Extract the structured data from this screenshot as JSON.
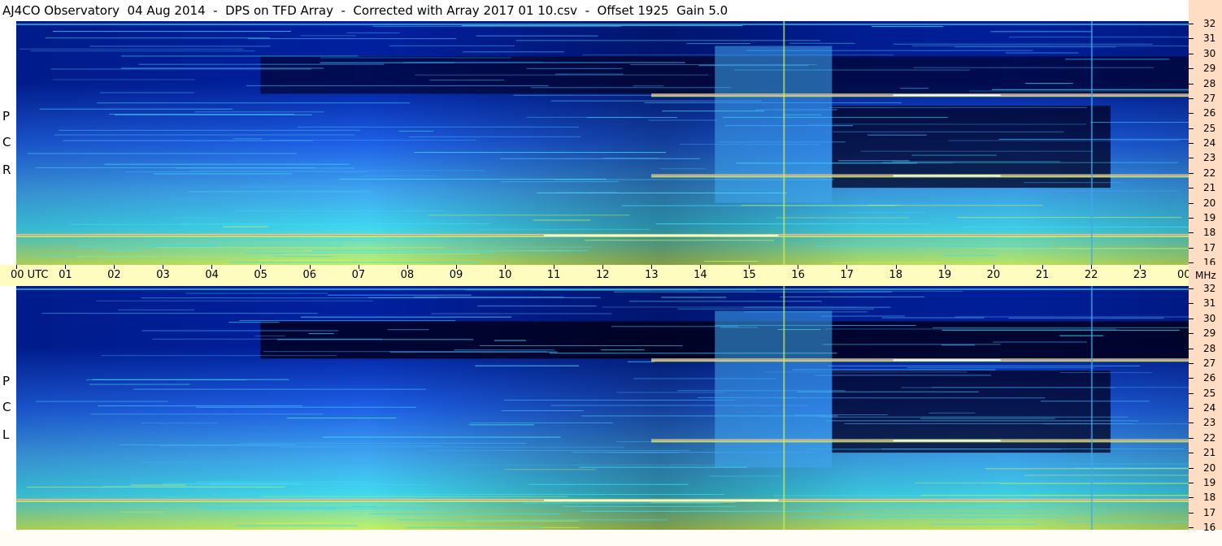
{
  "title": "AJ4CO Observatory  04 Aug 2014  -  DPS on TFD Array  -  Corrected with Array 2017 01 10.csv  -  Offset 1925  Gain 5.0",
  "polarizations": [
    {
      "key": "rcp",
      "letters": [
        "P",
        "C",
        "R"
      ]
    },
    {
      "key": "lcp",
      "letters": [
        "P",
        "C",
        "L"
      ]
    }
  ],
  "time_axis": {
    "labels": [
      "00 UTC",
      "01",
      "02",
      "03",
      "04",
      "05",
      "06",
      "07",
      "08",
      "09",
      "10",
      "11",
      "12",
      "13",
      "14",
      "15",
      "16",
      "17",
      "18",
      "19",
      "20",
      "21",
      "22",
      "23",
      "00"
    ],
    "unit_label": "MHz"
  },
  "freq_axis": {
    "labels": [
      "32",
      "31",
      "30",
      "29",
      "28",
      "27",
      "26",
      "25",
      "24",
      "23",
      "22",
      "21",
      "20",
      "19",
      "18",
      "17",
      "16"
    ]
  },
  "colors": {
    "deep": "#000020",
    "dark_blue": "#0020a0",
    "blue": "#1e60e8",
    "light_blue": "#40a8f0",
    "cyan": "#40d8f0",
    "green_yellow": "#c8f060",
    "magenta": "#ff40ff",
    "white": "#ffffff",
    "time_axis_bg": "#fffcbf",
    "freq_axis_bg": "#ffdcc4"
  },
  "chart_data": {
    "type": "heatmap",
    "title": "AJ4CO Observatory  04 Aug 2014  -  DPS on TFD Array  -  Corrected with Array 2017 01 10.csv  -  Offset 1925  Gain 5.0",
    "x_unit": "UTC hour",
    "xlim": [
      0,
      24
    ],
    "y_unit": "MHz",
    "ylim": [
      16,
      32
    ],
    "panels": [
      "RCP",
      "LCP"
    ],
    "features": [
      {
        "desc": "dark absorption band",
        "freq_mhz": 28.5,
        "hours": [
          5,
          24
        ]
      },
      {
        "desc": "strong interference line",
        "freq_mhz": 27.2,
        "hours": [
          13,
          24
        ]
      },
      {
        "desc": "strong interference line",
        "freq_mhz": 21.8,
        "hours": [
          13,
          24
        ]
      },
      {
        "desc": "strong interference line",
        "freq_mhz": 17.8,
        "hours": [
          0,
          24
        ]
      },
      {
        "desc": "bright broadband block",
        "hours": [
          14.3,
          16.7
        ]
      },
      {
        "desc": "vertical line",
        "hours": [
          15.7
        ]
      },
      {
        "desc": "vertical line",
        "hours": [
          22.0
        ]
      }
    ]
  }
}
